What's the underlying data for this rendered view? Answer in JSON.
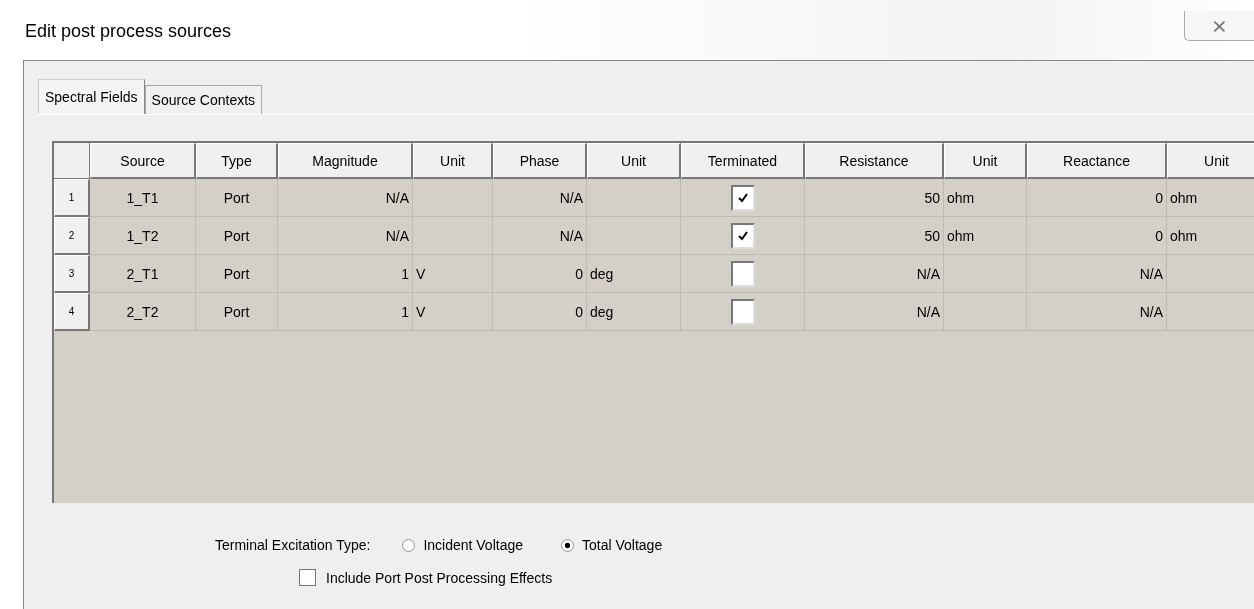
{
  "window": {
    "title": "Edit post process sources",
    "close_button": "⨯"
  },
  "tabs": [
    {
      "label": "Spectral Fields",
      "selected": true
    },
    {
      "label": "Source Contexts",
      "selected": false
    }
  ],
  "table": {
    "columns": [
      "Source",
      "Type",
      "Magnitude",
      "Unit",
      "Phase",
      "Unit",
      "Terminated",
      "Resistance",
      "Unit",
      "Reactance",
      "Unit"
    ],
    "rows": [
      {
        "index": "1",
        "source": "1_T1",
        "type": "Port",
        "magnitude": "N/A",
        "magnitude_unit": "",
        "phase": "N/A",
        "phase_unit": "",
        "terminated": true,
        "resistance": "50",
        "resistance_unit": "ohm",
        "reactance": "0",
        "reactance_unit": "ohm"
      },
      {
        "index": "2",
        "source": "1_T2",
        "type": "Port",
        "magnitude": "N/A",
        "magnitude_unit": "",
        "phase": "N/A",
        "phase_unit": "",
        "terminated": true,
        "resistance": "50",
        "resistance_unit": "ohm",
        "reactance": "0",
        "reactance_unit": "ohm"
      },
      {
        "index": "3",
        "source": "2_T1",
        "type": "Port",
        "magnitude": "1",
        "magnitude_unit": "V",
        "phase": "0",
        "phase_unit": "deg",
        "terminated": false,
        "resistance": "N/A",
        "resistance_unit": "",
        "reactance": "N/A",
        "reactance_unit": ""
      },
      {
        "index": "4",
        "source": "2_T2",
        "type": "Port",
        "magnitude": "1",
        "magnitude_unit": "V",
        "phase": "0",
        "phase_unit": "deg",
        "terminated": false,
        "resistance": "N/A",
        "resistance_unit": "",
        "reactance": "N/A",
        "reactance_unit": ""
      }
    ]
  },
  "excitation": {
    "label": "Terminal Excitation Type:",
    "options": [
      {
        "label": "Incident Voltage",
        "selected": false
      },
      {
        "label": "Total Voltage",
        "selected": true
      }
    ]
  },
  "include_port_effects": {
    "label": "Include Port Post Processing Effects",
    "checked": false
  }
}
